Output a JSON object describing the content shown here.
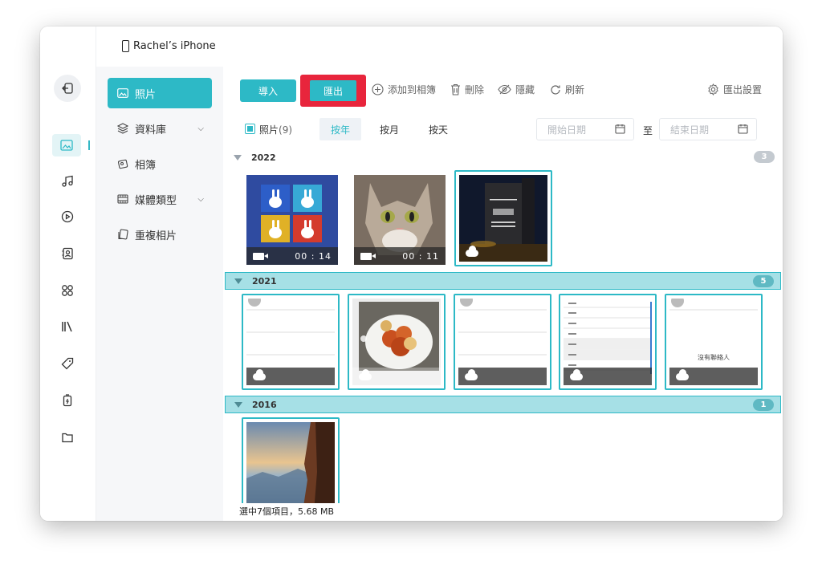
{
  "window": {
    "device_name": "Rachel’s iPhone"
  },
  "rail": {
    "items": [
      "back-icon",
      "photos-icon",
      "music-icon",
      "video-icon",
      "contacts-icon",
      "apps-icon",
      "books-icon",
      "ringtone-icon",
      "battery-icon",
      "files-icon"
    ]
  },
  "sidebar": {
    "items": [
      {
        "label": "照片",
        "icon": "photo-icon"
      },
      {
        "label": "資料庫",
        "icon": "layers-icon"
      },
      {
        "label": "相簿",
        "icon": "album-icon"
      },
      {
        "label": "媒體類型",
        "icon": "film-icon"
      },
      {
        "label": "重複相片",
        "icon": "duplicate-icon"
      }
    ]
  },
  "toolbar": {
    "import_label": "導入",
    "export_label": "匯出",
    "add_album_label": "添加到相簿",
    "delete_label": "刪除",
    "hide_label": "隱藏",
    "refresh_label": "刷新",
    "export_settings_label": "匯出設置"
  },
  "filter": {
    "photos_label": "照片",
    "photos_count": "(9)",
    "by_year": "按年",
    "by_month": "按月",
    "by_day": "按天",
    "start_placeholder": "開始日期",
    "to_label": "至",
    "end_placeholder": "結束日期"
  },
  "groups": [
    {
      "year": "2022",
      "count": "3"
    },
    {
      "year": "2021",
      "count": "5"
    },
    {
      "year": "2016",
      "count": "1"
    }
  ],
  "thumbs": {
    "video1_duration": "00 : 14",
    "video2_duration": "00 : 11",
    "contacts_empty": "沒有聯絡人"
  },
  "status": {
    "text": "選中7個項目，5.68 MB"
  },
  "colors": {
    "accent": "#2db9c6",
    "highlight": "#e8253c"
  }
}
